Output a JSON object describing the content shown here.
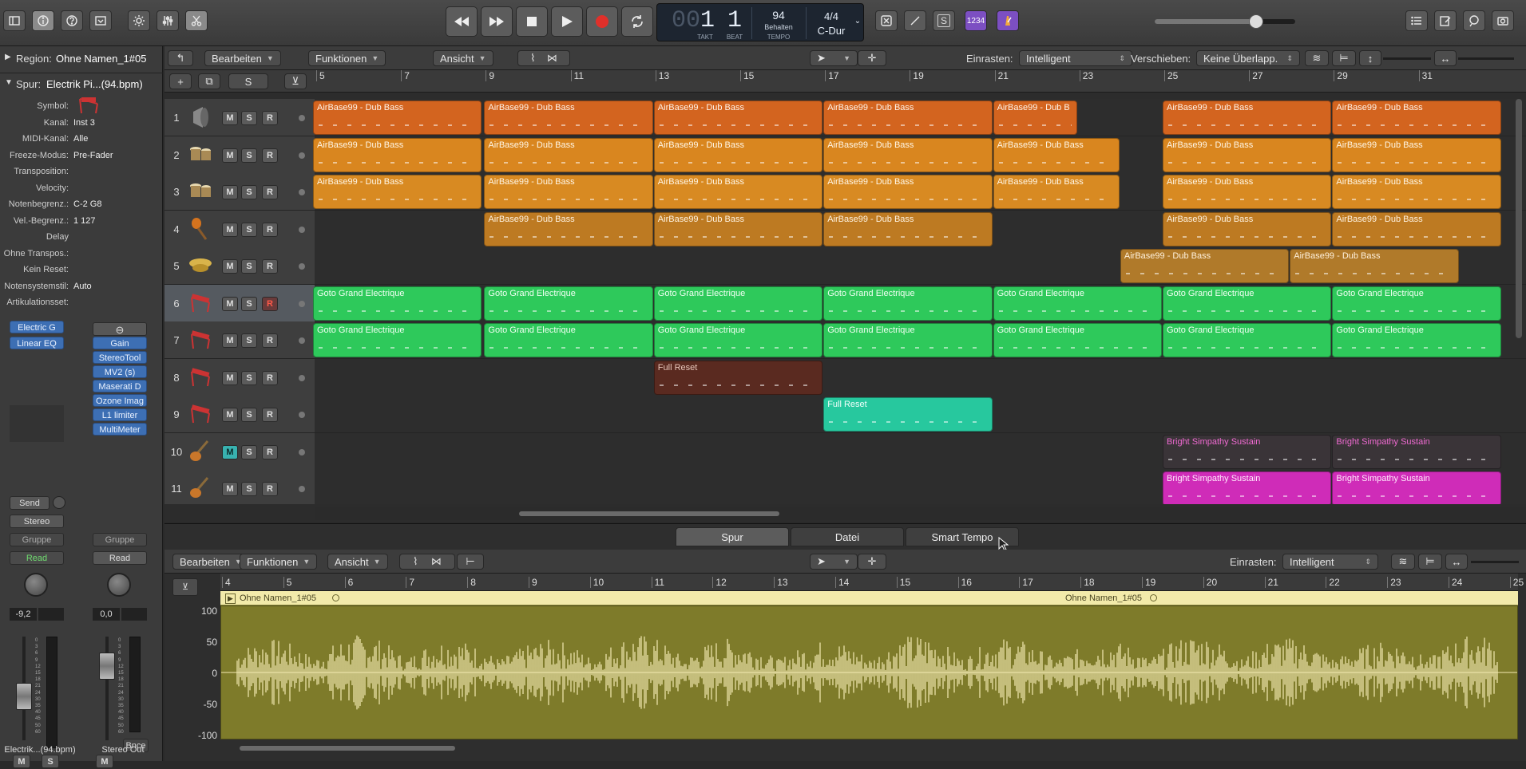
{
  "control_bar": {
    "left_buttons": [
      "library-icon",
      "info-icon",
      "help-icon",
      "inbox-icon",
      "sun-icon",
      "mixer-sliders-icon",
      "scissors-icon"
    ],
    "transport_icons": [
      "rewind-icon",
      "fast-forward-icon",
      "stop-icon",
      "play-icon",
      "record-icon",
      "cycle-icon"
    ],
    "lcd": {
      "takt": "00 1",
      "takt_dim": "00",
      "takt_value": "1",
      "beat": "1",
      "tempo": "94",
      "tempo_mode": "Behalten",
      "signature": "4/4",
      "key": "C-Dur",
      "labels": {
        "takt": "TAKT",
        "beat": "BEAT",
        "tempo": "TEMPO"
      }
    },
    "right_mode_buttons": [
      "replace-icon",
      "tuner-icon",
      "solo-s-icon"
    ],
    "count_in": "1234",
    "master_volume_level": 0.72,
    "view_buttons": [
      "list-icon",
      "notepad-icon",
      "loop-browser-icon",
      "browser-icon"
    ]
  },
  "inspector": {
    "region_label": "Region:",
    "region_name": "Ohne Namen_1#05",
    "track_label": "Spur:",
    "track_name": "Electrik Pi...(94.bpm)",
    "params": [
      {
        "k": "Symbol:",
        "v": ""
      },
      {
        "k": "Kanal:",
        "v": "Inst 3"
      },
      {
        "k": "MIDI-Kanal:",
        "v": "Alle"
      },
      {
        "k": "Freeze-Modus:",
        "v": "Pre-Fader"
      },
      {
        "k": "Transposition:",
        "v": ""
      },
      {
        "k": "Velocity:",
        "v": ""
      },
      {
        "k": "Notenbegrenz.:",
        "v": "C-2  G8"
      },
      {
        "k": "Vel.-Begrenz.:",
        "v": "1  127"
      },
      {
        "k": "Delay",
        "v": ""
      },
      {
        "k": "Ohne Transpos.:",
        "v": ""
      },
      {
        "k": "Kein Reset:",
        "v": ""
      },
      {
        "k": "Notensystemstil:",
        "v": "Auto"
      },
      {
        "k": "Artikulationsset:",
        "v": ""
      }
    ],
    "strip1": {
      "inserts": [
        "Electric G",
        "Linear EQ"
      ],
      "send": "Send",
      "output": "Stereo",
      "group": "Gruppe",
      "automation": "Read",
      "pan_value": "-9,2",
      "name": "Electrik...(94.bpm)",
      "mute": "M",
      "solo": "S"
    },
    "strip2": {
      "inserts": [
        "Gain",
        "StereoTool",
        "MV2 (s)",
        "Maserati D",
        "Ozone Imag",
        "L1 limiter",
        "MultiMeter"
      ],
      "group": "Gruppe",
      "automation": "Read",
      "pan_value": "0,0",
      "name": "Stereo Out",
      "mute": "M",
      "bounce": "Bnce"
    },
    "meter_scale": [
      "0",
      "3",
      "6",
      "9",
      "12",
      "15",
      "18",
      "21",
      "24",
      "30",
      "35",
      "40",
      "45",
      "50",
      "60"
    ]
  },
  "arrange": {
    "menus": {
      "edit": "Bearbeiten",
      "functions": "Funktionen",
      "view": "Ansicht"
    },
    "snap_label": "Einrasten:",
    "snap_value": "Intelligent",
    "drag_label": "Verschieben:",
    "drag_value": "Keine Überlapp.",
    "header_buttons": {
      "add": "+",
      "solo": "S"
    },
    "ruler": [
      "5",
      "7",
      "9",
      "11",
      "13",
      "15",
      "17",
      "19",
      "21",
      "23",
      "25",
      "27",
      "29",
      "31"
    ],
    "tracks": [
      {
        "num": "1",
        "icon": "speaker-icon",
        "m": "M",
        "s": "S",
        "r": "R",
        "mute_on": false,
        "rec_on": false,
        "sel": false,
        "regions": [
          {
            "name": "AirBase99 - Dub Bass",
            "start": 5,
            "end": 9,
            "color": "c-or1"
          },
          {
            "name": "AirBase99 - Dub Bass",
            "start": 9,
            "end": 13,
            "color": "c-or1"
          },
          {
            "name": "AirBase99 - Dub Bass",
            "start": 13,
            "end": 17,
            "color": "c-or1"
          },
          {
            "name": "AirBase99 - Dub Bass",
            "start": 17,
            "end": 21,
            "color": "c-or1"
          },
          {
            "name": "AirBase99 - Dub B",
            "start": 21,
            "end": 23,
            "color": "c-or1"
          },
          {
            "name": "AirBase99 - Dub Bass",
            "start": 25,
            "end": 29,
            "color": "c-or1"
          },
          {
            "name": "AirBase99 - Dub Bass",
            "start": 29,
            "end": 33,
            "color": "c-or1"
          }
        ]
      },
      {
        "num": "2",
        "icon": "bongo-icon",
        "m": "M",
        "s": "S",
        "r": "R",
        "mute_on": false,
        "rec_on": false,
        "sel": false,
        "regions": [
          {
            "name": "AirBase99 - Dub Bass",
            "start": 5,
            "end": 9,
            "color": "c-or2"
          },
          {
            "name": "AirBase99 - Dub Bass",
            "start": 9,
            "end": 13,
            "color": "c-or2"
          },
          {
            "name": "AirBase99 - Dub Bass",
            "start": 13,
            "end": 17,
            "color": "c-or2"
          },
          {
            "name": "AirBase99 - Dub Bass",
            "start": 17,
            "end": 21,
            "color": "c-or2"
          },
          {
            "name": "AirBase99 - Dub Bass",
            "start": 21,
            "end": 24,
            "color": "c-or2"
          },
          {
            "name": "AirBase99 - Dub Bass",
            "start": 25,
            "end": 29,
            "color": "c-or2"
          },
          {
            "name": "AirBase99 - Dub Bass",
            "start": 29,
            "end": 33,
            "color": "c-or2"
          }
        ]
      },
      {
        "num": "3",
        "icon": "bongo-icon",
        "m": "M",
        "s": "S",
        "r": "R",
        "mute_on": false,
        "rec_on": false,
        "sel": false,
        "regions": [
          {
            "name": "AirBase99 - Dub Bass",
            "start": 5,
            "end": 9,
            "color": "c-or3"
          },
          {
            "name": "AirBase99 - Dub Bass",
            "start": 9,
            "end": 13,
            "color": "c-or3"
          },
          {
            "name": "AirBase99 - Dub Bass",
            "start": 13,
            "end": 17,
            "color": "c-or3"
          },
          {
            "name": "AirBase99 - Dub Bass",
            "start": 17,
            "end": 21,
            "color": "c-or3"
          },
          {
            "name": "AirBase99 - Dub Bass",
            "start": 21,
            "end": 24,
            "color": "c-or3"
          },
          {
            "name": "AirBase99 - Dub Bass",
            "start": 25,
            "end": 29,
            "color": "c-or3"
          },
          {
            "name": "AirBase99 - Dub Bass",
            "start": 29,
            "end": 33,
            "color": "c-or3"
          }
        ]
      },
      {
        "num": "4",
        "icon": "maracas-icon",
        "m": "M",
        "s": "S",
        "r": "R",
        "mute_on": false,
        "rec_on": false,
        "sel": false,
        "regions": [
          {
            "name": "AirBase99 - Dub Bass",
            "start": 9,
            "end": 13,
            "color": "c-or4"
          },
          {
            "name": "AirBase99 - Dub Bass",
            "start": 13,
            "end": 17,
            "color": "c-or4"
          },
          {
            "name": "AirBase99 - Dub Bass",
            "start": 17,
            "end": 21,
            "color": "c-or4"
          },
          {
            "name": "AirBase99 - Dub Bass",
            "start": 25,
            "end": 29,
            "color": "c-or4"
          },
          {
            "name": "AirBase99 - Dub Bass",
            "start": 29,
            "end": 33,
            "color": "c-or4"
          }
        ]
      },
      {
        "num": "5",
        "icon": "cymbal-icon",
        "m": "M",
        "s": "S",
        "r": "R",
        "mute_on": false,
        "rec_on": false,
        "sel": false,
        "regions": [
          {
            "name": "AirBase99 - Dub Bass",
            "start": 24,
            "end": 28,
            "color": "c-or5"
          },
          {
            "name": "AirBase99 - Dub Bass",
            "start": 28,
            "end": 32,
            "color": "c-or5"
          }
        ]
      },
      {
        "num": "6",
        "icon": "keyboard-icon",
        "m": "M",
        "s": "S",
        "r": "R",
        "mute_on": false,
        "rec_on": true,
        "sel": true,
        "regions": [
          {
            "name": "Goto Grand Electrique",
            "start": 5,
            "end": 9,
            "color": "c-gr"
          },
          {
            "name": "Goto Grand Electrique",
            "start": 9,
            "end": 13,
            "color": "c-gr"
          },
          {
            "name": "Goto Grand Electrique",
            "start": 13,
            "end": 17,
            "color": "c-gr"
          },
          {
            "name": "Goto Grand Electrique",
            "start": 17,
            "end": 21,
            "color": "c-gr"
          },
          {
            "name": "Goto Grand Electrique",
            "start": 21,
            "end": 25,
            "color": "c-gr"
          },
          {
            "name": "Goto Grand Electrique",
            "start": 25,
            "end": 29,
            "color": "c-gr"
          },
          {
            "name": "Goto Grand Electrique",
            "start": 29,
            "end": 33,
            "color": "c-gr"
          }
        ]
      },
      {
        "num": "7",
        "icon": "keyboard-icon",
        "m": "M",
        "s": "S",
        "r": "R",
        "mute_on": false,
        "rec_on": false,
        "sel": false,
        "regions": [
          {
            "name": "Goto Grand Electrique",
            "start": 5,
            "end": 9,
            "color": "c-gr"
          },
          {
            "name": "Goto Grand Electrique",
            "start": 9,
            "end": 13,
            "color": "c-gr"
          },
          {
            "name": "Goto Grand Electrique",
            "start": 13,
            "end": 17,
            "color": "c-gr"
          },
          {
            "name": "Goto Grand Electrique",
            "start": 17,
            "end": 21,
            "color": "c-gr"
          },
          {
            "name": "Goto Grand Electrique",
            "start": 21,
            "end": 25,
            "color": "c-gr"
          },
          {
            "name": "Goto Grand Electrique",
            "start": 25,
            "end": 29,
            "color": "c-gr"
          },
          {
            "name": "Goto Grand Electrique",
            "start": 29,
            "end": 33,
            "color": "c-gr"
          }
        ]
      },
      {
        "num": "8",
        "icon": "keyboard-icon",
        "m": "M",
        "s": "S",
        "r": "R",
        "mute_on": false,
        "rec_on": false,
        "sel": false,
        "regions": [
          {
            "name": "Full Reset",
            "start": 13,
            "end": 17,
            "color": "c-dk"
          }
        ]
      },
      {
        "num": "9",
        "icon": "keyboard-icon",
        "m": "M",
        "s": "S",
        "r": "R",
        "mute_on": false,
        "rec_on": false,
        "sel": false,
        "regions": [
          {
            "name": "Full Reset",
            "start": 17,
            "end": 21,
            "color": "c-tl"
          }
        ]
      },
      {
        "num": "10",
        "icon": "guitar-icon",
        "m": "M",
        "s": "S",
        "r": "R",
        "mute_on": true,
        "rec_on": false,
        "sel": false,
        "regions": [
          {
            "name": "Bright Simpathy Sustain",
            "start": 25,
            "end": 29,
            "color": "c-pk"
          },
          {
            "name": "Bright Simpathy Sustain",
            "start": 29,
            "end": 33,
            "color": "c-pk"
          }
        ]
      },
      {
        "num": "11",
        "icon": "guitar-icon",
        "m": "M",
        "s": "S",
        "r": "R",
        "mute_on": false,
        "rec_on": false,
        "sel": false,
        "regions": [
          {
            "name": "Bright Simpathy Sustain",
            "start": 25,
            "end": 29,
            "color": "c-pk2"
          },
          {
            "name": "Bright Simpathy Sustain",
            "start": 29,
            "end": 33,
            "color": "c-pk2"
          }
        ]
      }
    ]
  },
  "editor": {
    "tabs": [
      {
        "label": "Spur",
        "active": true
      },
      {
        "label": "Datei",
        "active": false
      },
      {
        "label": "Smart Tempo",
        "active": false
      }
    ],
    "menus": {
      "edit": "Bearbeiten",
      "functions": "Funktionen",
      "view": "Ansicht"
    },
    "snap_label": "Einrasten:",
    "snap_value": "Intelligent",
    "ruler": [
      "4",
      "5",
      "6",
      "7",
      "8",
      "9",
      "10",
      "11",
      "12",
      "13",
      "14",
      "15",
      "16",
      "17",
      "18",
      "19",
      "20",
      "21",
      "22",
      "23",
      "24",
      "25"
    ],
    "region_name": "Ohne Namen_1#05",
    "region_name_2": "Ohne Namen_1#05",
    "y_axis": [
      "100",
      "50",
      "0",
      "-50",
      "-100"
    ]
  }
}
